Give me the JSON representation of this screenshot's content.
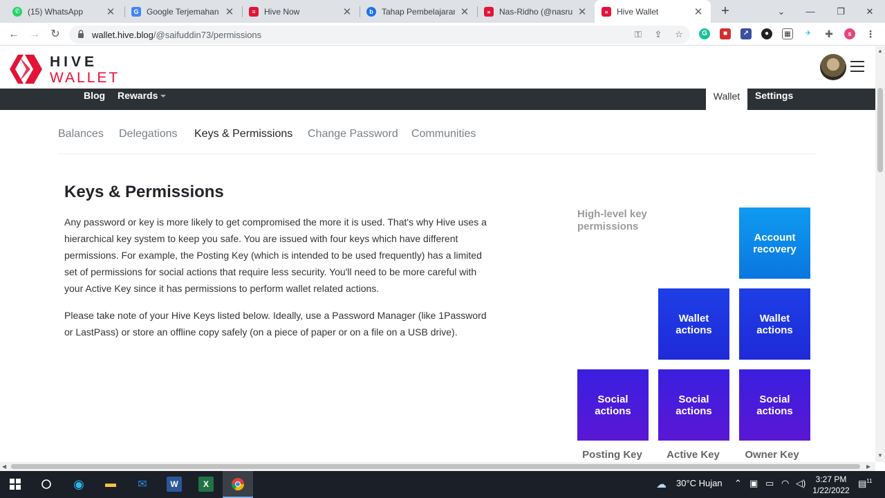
{
  "browser": {
    "tabs": [
      {
        "title": "(15) WhatsApp",
        "icon": "whatsapp-icon",
        "color": "#25d366"
      },
      {
        "title": "Google Terjemahan",
        "icon": "google-translate-icon",
        "color": "#4285f4"
      },
      {
        "title": "Hive Now",
        "icon": "hive-now-icon",
        "color": "#e31337"
      },
      {
        "title": "Tahap Pembelajaran C",
        "icon": "learning-icon",
        "color": "#1a73e8"
      },
      {
        "title": "Nas-Ridho (@nasrud",
        "icon": "hive-icon",
        "color": "#e31337"
      },
      {
        "title": "Hive Wallet",
        "icon": "hive-icon",
        "color": "#e31337",
        "active": true
      }
    ],
    "url_host": "wallet.hive.blog",
    "url_path": "/@saifuddin73/permissions"
  },
  "hive": {
    "wordmark_top": "HIVE",
    "wordmark_bottom": "WALLET",
    "nav": {
      "blog": "Blog",
      "rewards": "Rewards",
      "wallet": "Wallet",
      "settings": "Settings"
    },
    "subtabs": [
      "Balances",
      "Delegations",
      "Keys & Permissions",
      "Change Password",
      "Communities"
    ],
    "active_subtab": "Keys & Permissions"
  },
  "content": {
    "title": "Keys & Permissions",
    "para1": "Any password or key is more likely to get compromised the more it is used. That's why Hive uses a hierarchical key system to keep you safe. You are issued with four keys which have different permissions. For example, the Posting Key (which is intended to be used frequently) has a limited set of permissions for social actions that require less security. You'll need to be more careful with your Active Key since it has permissions to perform wallet related actions.",
    "para2": "Please take note of your Hive Keys listed below. Ideally, use a Password Manager (like 1Password or LastPass) or store an offline copy safely (on a piece of paper or on a file on a USB drive)."
  },
  "diagram": {
    "high_level_label": "High-level key permissions",
    "boxes": {
      "account_recovery": "Account recovery",
      "wallet_actions": "Wallet actions",
      "social_actions": "Social actions"
    },
    "keys": {
      "posting": "Posting Key",
      "active": "Active Key",
      "owner": "Owner Key"
    },
    "colors": {
      "recovery": "#0c8ee8",
      "wallet": "#1f35e0",
      "social": "#4a1bd8"
    }
  },
  "taskbar": {
    "weather": "30°C  Hujan",
    "time": "3:27 PM",
    "date": "1/22/2022",
    "notifications": "11"
  }
}
